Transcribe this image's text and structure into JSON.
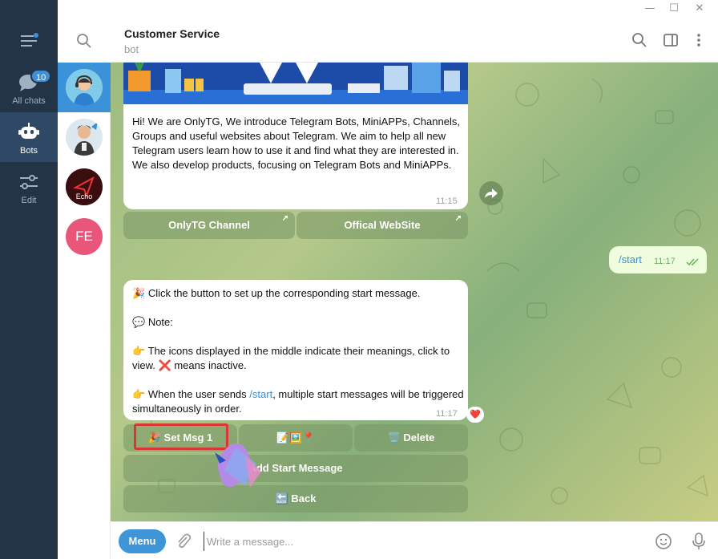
{
  "window": {
    "minimize": "—",
    "maximize": "☐",
    "close": "✕"
  },
  "nav": {
    "all_chats_label": "All chats",
    "all_chats_badge": "10",
    "bots_label": "Bots",
    "edit_label": "Edit"
  },
  "chat_list": {
    "items": [
      {
        "avatar_text": ""
      },
      {
        "avatar_text": ""
      },
      {
        "avatar_text": "Echo"
      },
      {
        "avatar_text": "FE"
      }
    ]
  },
  "header": {
    "title": "Customer Service",
    "subtitle": "bot"
  },
  "messages": {
    "intro": {
      "text": "Hi! We are OnlyTG, We introduce Telegram Bots, MiniAPPs, Channels, Groups and useful websites about Telegram. We aim to help all new Telegram users learn how to use it and find what they are interested in. We also develop products, focusing on Telegram Bots and MiniAPPs.",
      "time": "11:15",
      "buttons": [
        "OnlyTG Channel",
        "Offical WebSite"
      ]
    },
    "outgoing": {
      "text": "/start",
      "time": "11:17"
    },
    "setup": {
      "line1_emoji": "🎉",
      "line1": "Click the button to set up the corresponding start message.",
      "note_emoji": "💬",
      "note": "Note:",
      "line2_emoji": "👉",
      "line2": "The icons displayed in the middle indicate their meanings, click to view.",
      "line2_x": "❌",
      "line2_tail": "means inactive.",
      "line3_emoji": "👉",
      "line3_a": "When the user sends",
      "line3_link": "/start",
      "line3_b": ", multiple start messages will be triggered simultaneously in order.",
      "time": "11:17",
      "reaction": "❤️",
      "buttons": {
        "set_msg": "🎉 Set Msg 1",
        "icons": "📝🖼️📍",
        "delete": "🗑️ Delete",
        "add": "Add Start Message",
        "back": "🔙 Back"
      }
    }
  },
  "input": {
    "menu_label": "Menu",
    "placeholder": "Write a message..."
  },
  "colors": {
    "accent": "#3e95d7",
    "highlight_border": "#d93636",
    "nav_bg": "#243447"
  }
}
